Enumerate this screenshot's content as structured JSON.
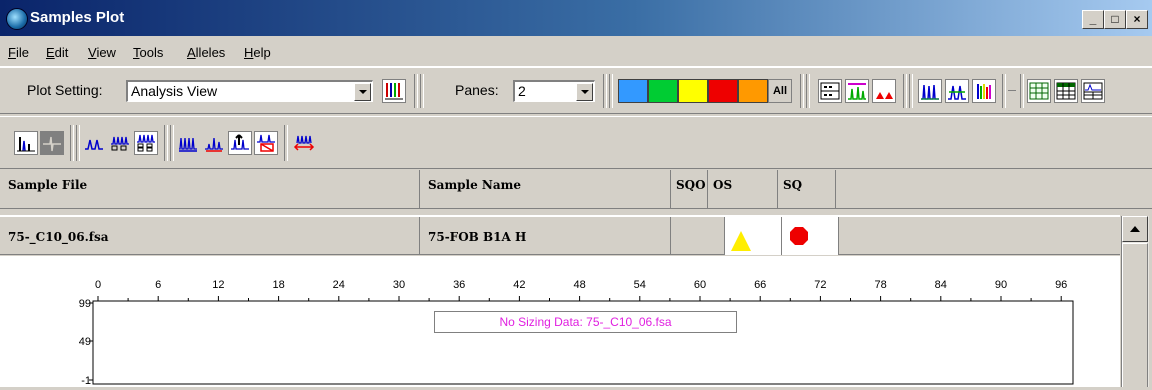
{
  "window": {
    "title": "Samples Plot",
    "buttons": {
      "minimize": "_",
      "maximize": "□",
      "close": "×"
    }
  },
  "menu": [
    "File",
    "Edit",
    "View",
    "Tools",
    "Alleles",
    "Help"
  ],
  "toolbar": {
    "plot_setting_label": "Plot Setting:",
    "plot_setting_value": "Analysis View",
    "panes_label": "Panes:",
    "panes_value": "2",
    "dye_colors": [
      "#3399ff",
      "#00cc33",
      "#ffff00",
      "#ee0000",
      "#ff9900"
    ],
    "all_label": "All"
  },
  "table": {
    "headers": [
      "Sample File",
      "Sample Name",
      "SQO",
      "OS",
      "SQ"
    ],
    "rows": [
      {
        "sample_file": "75-_C10_06.fsa",
        "sample_name": "75-FOB B1A H",
        "sqo": "",
        "os_icon": "yellow-triangle-icon",
        "sq_icon": "red-stop-octagon-icon"
      }
    ]
  },
  "plot": {
    "x_ticks": [
      "0",
      "6",
      "12",
      "18",
      "24",
      "30",
      "36",
      "42",
      "48",
      "54",
      "60",
      "66",
      "72",
      "78",
      "84",
      "90",
      "96"
    ],
    "y_ticks": [
      "99",
      "49",
      "-1"
    ],
    "message": "No Sizing Data: 75-_C10_06.fsa"
  },
  "colors": {
    "title_start": "#0a246a",
    "title_end": "#a6caf0",
    "message": "#e020e0",
    "os_flag": "#ffee00",
    "sq_flag": "#ee0000"
  }
}
